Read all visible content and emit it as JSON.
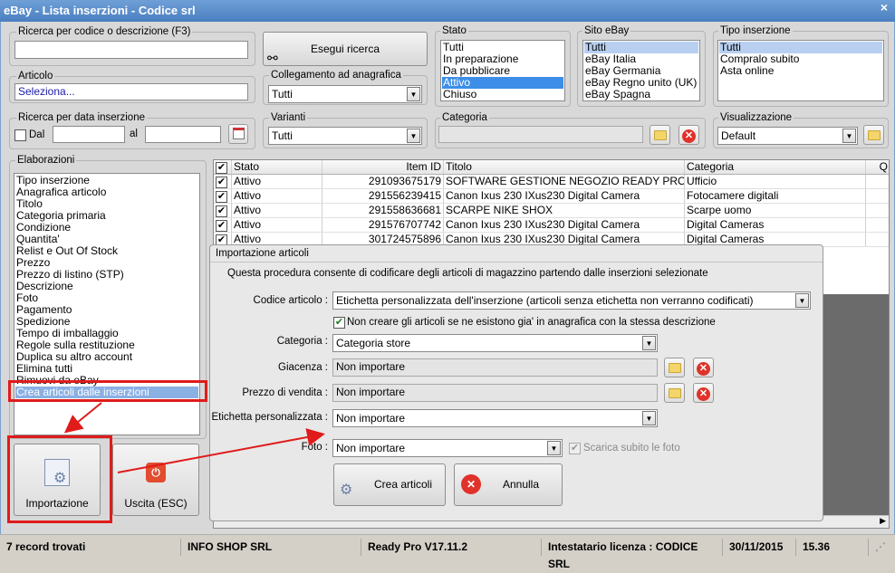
{
  "window": {
    "title": "eBay - Lista inserzioni - Codice srl",
    "close": "×"
  },
  "search": {
    "label": "Ricerca per codice o descrizione (F3)",
    "value": "",
    "button": "Esegui ricerca"
  },
  "articolo": {
    "label": "Articolo",
    "value": "Seleziona..."
  },
  "collegamento": {
    "label": "Collegamento ad anagrafica",
    "value": "Tutti"
  },
  "stato": {
    "label": "Stato",
    "items": [
      "Tutti",
      "In preparazione",
      "Da pubblicare",
      "Attivo",
      "Chiuso"
    ],
    "selected": "Attivo"
  },
  "sito": {
    "label": "Sito eBay",
    "items": [
      "Tutti",
      "eBay Italia",
      "eBay Germania",
      "eBay Regno unito (UK)",
      "eBay Spagna"
    ],
    "selected": "Tutti"
  },
  "tipo": {
    "label": "Tipo inserzione",
    "items": [
      "Tutti",
      "Compralo subito",
      "Asta online"
    ],
    "selected": "Tutti"
  },
  "data": {
    "label": "Ricerca per data inserzione",
    "dal": "Dal",
    "al": "al",
    "dal_value": "",
    "al_value": ""
  },
  "varianti": {
    "label": "Varianti",
    "value": "Tutti"
  },
  "categoria": {
    "label": "Categoria",
    "value": ""
  },
  "visualizzazione": {
    "label": "Visualizzazione",
    "value": "Default"
  },
  "elaborazioni": {
    "label": "Elaborazioni",
    "items": [
      "Tipo inserzione",
      "Anagrafica articolo",
      "Titolo",
      "Categoria primaria",
      "Condizione",
      "Quantita'",
      "Relist e Out Of Stock",
      "Prezzo",
      "Prezzo di listino (STP)",
      "Descrizione",
      "Foto",
      "Pagamento",
      "Spedizione",
      "Tempo di imballaggio",
      "Regole sulla restituzione",
      "Duplica su altro account",
      "Elimina tutti",
      "Rimuovi da eBay",
      "Crea articoli dalle inserzioni"
    ],
    "selected": "Crea articoli dalle inserzioni"
  },
  "buttons": {
    "importazione": "Importazione",
    "uscita": "Uscita (ESC)"
  },
  "grid": {
    "headers": [
      "Stato",
      "Item ID",
      "Titolo",
      "Categoria",
      "Q"
    ],
    "rows": [
      {
        "stato": "Attivo",
        "id": "291093675179",
        "titolo": "SOFTWARE GESTIONE NEGOZIO READY PRO",
        "categoria": "Ufficio"
      },
      {
        "stato": "Attivo",
        "id": "291556239415",
        "titolo": "Canon Ixus 230 IXus230 Digital Camera",
        "categoria": "Fotocamere digitali"
      },
      {
        "stato": "Attivo",
        "id": "291558636681",
        "titolo": "SCARPE NIKE SHOX",
        "categoria": "Scarpe uomo"
      },
      {
        "stato": "Attivo",
        "id": "291576707742",
        "titolo": "Canon Ixus 230 IXus230 Digital Camera",
        "categoria": "Digital Cameras"
      },
      {
        "stato": "Attivo",
        "id": "301724575896",
        "titolo": "Canon Ixus 230 IXus230 Digital Camera",
        "categoria": "Digital Cameras"
      }
    ]
  },
  "dialog": {
    "title": "Importazione articoli",
    "description": "Questa procedura consente di codificare degli articoli di magazzino partendo dalle inserzioni selezionate",
    "codice_label": "Codice articolo :",
    "codice_value": "Etichetta personalizzata dell'inserzione (articoli senza etichetta non verranno codificati)",
    "non_creare": "Non creare gli articoli se ne esistono gia' in anagrafica con la stessa descrizione",
    "categoria_label": "Categoria :",
    "categoria_value": "Categoria store",
    "giacenza_label": "Giacenza :",
    "giacenza_value": "Non importare",
    "prezzo_label": "Prezzo di vendita :",
    "prezzo_value": "Non importare",
    "etichetta_label": "Etichetta personalizzata :",
    "etichetta_value": "Non importare",
    "foto_label": "Foto :",
    "foto_value": "Non importare",
    "scarica": "Scarica subito le foto",
    "crea": "Crea articoli",
    "annulla": "Annulla"
  },
  "statusbar": {
    "records": "7 record trovati",
    "company": "INFO SHOP SRL",
    "version": "Ready Pro V17.11.2",
    "licenza": "Intestatario licenza : CODICE SRL",
    "date": "30/11/2015",
    "time": "15.36"
  },
  "colors": {
    "highlight": "#e01b1b",
    "selection": "#3399ff",
    "title": "#4a7fc1"
  }
}
